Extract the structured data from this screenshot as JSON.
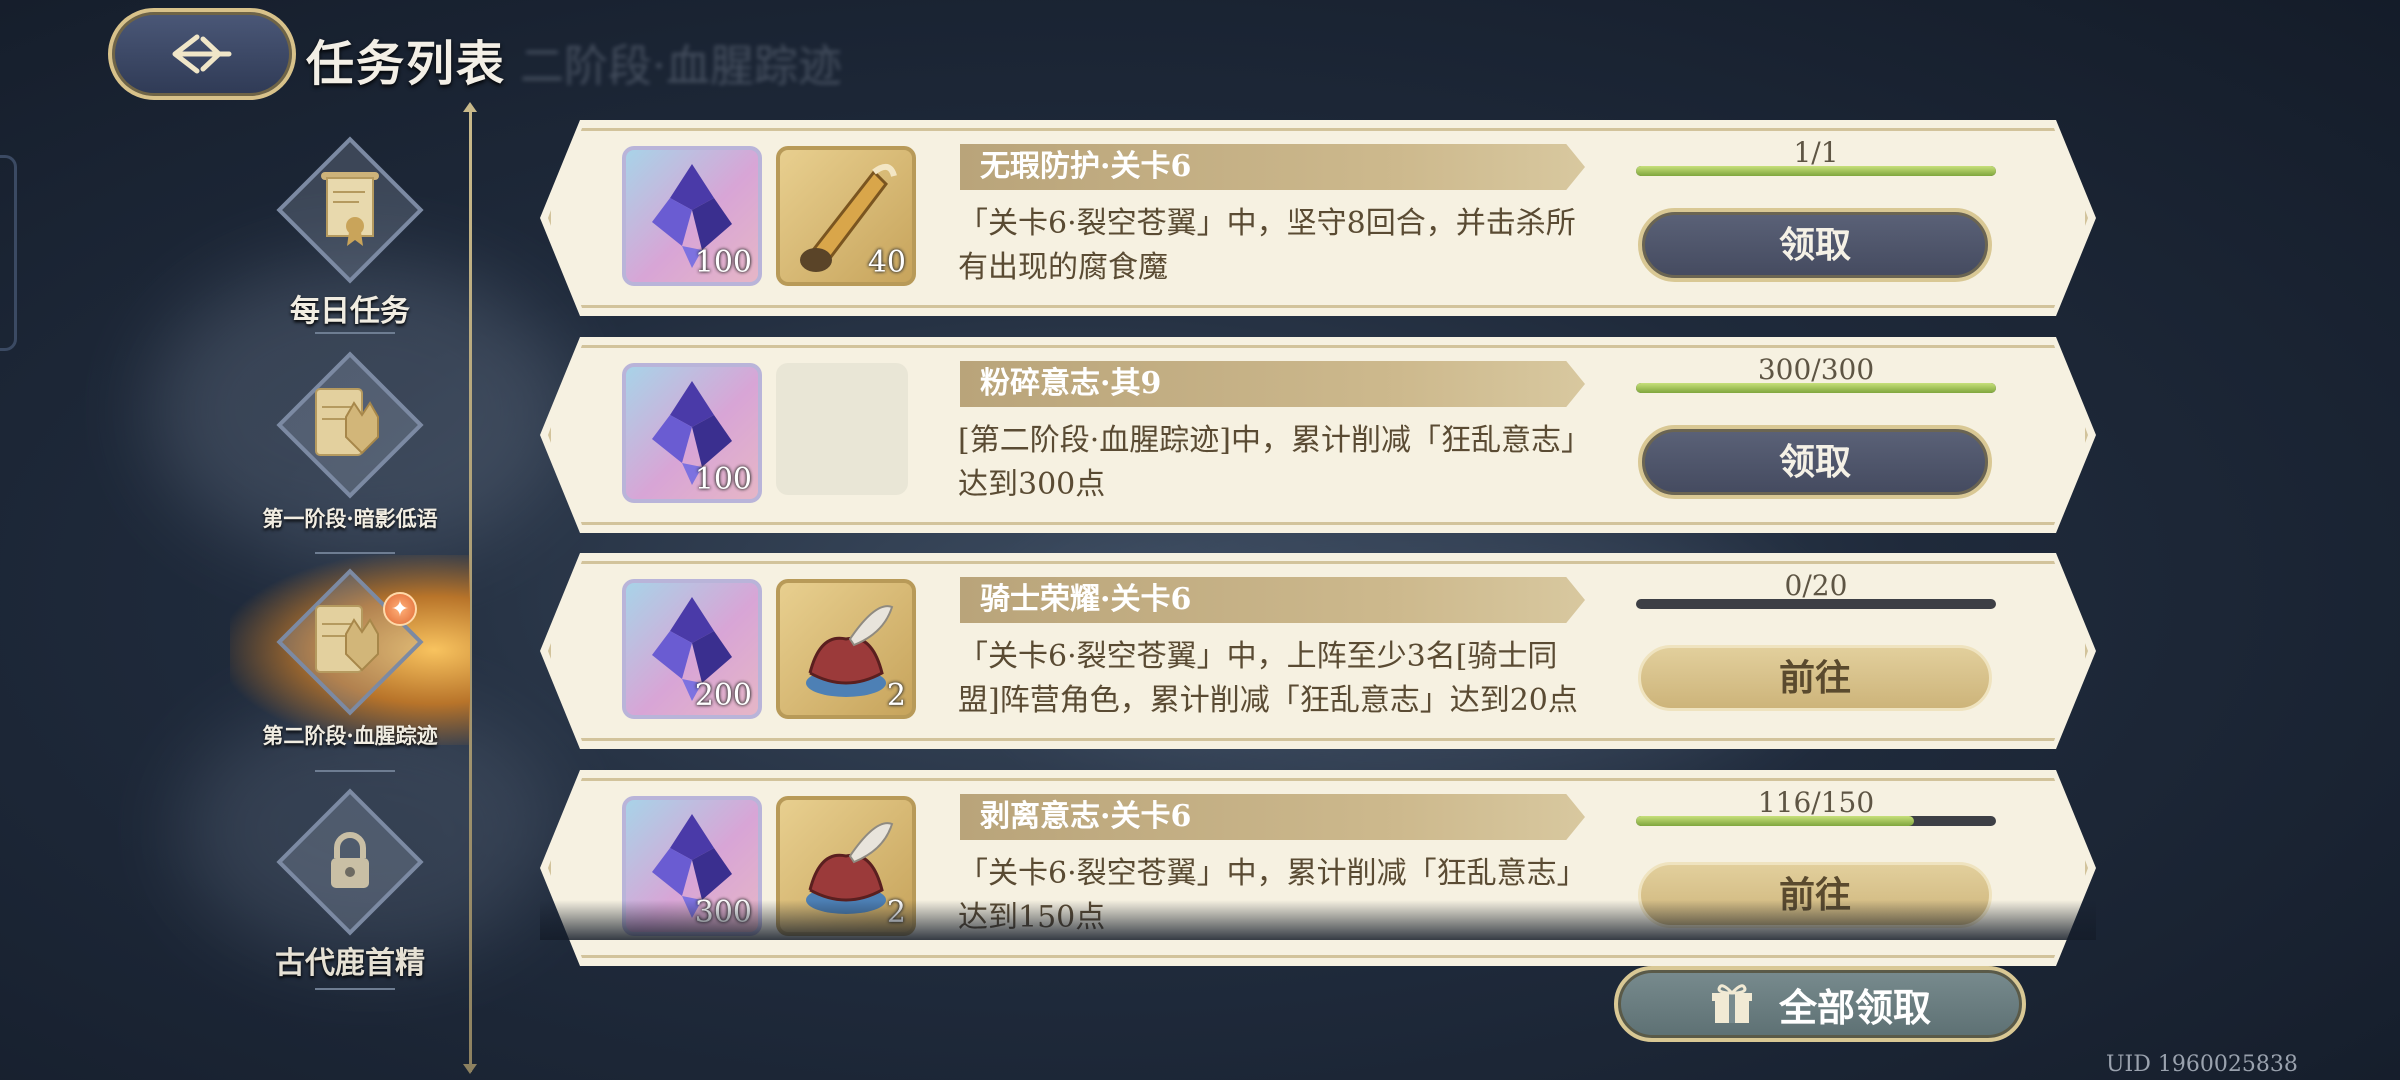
{
  "header": {
    "title": "任务列表",
    "subtitle_ghost": "二阶段·血腥踪迹"
  },
  "sidebar": {
    "items": [
      {
        "label": "每日任务",
        "icon": "scroll-icon",
        "state": "normal"
      },
      {
        "label": "第一阶段·暗影低语",
        "icon": "wolf-card-icon",
        "state": "normal"
      },
      {
        "label": "第二阶段·血腥踪迹",
        "icon": "wolf-card-icon",
        "state": "active",
        "badge": "✦"
      },
      {
        "label": "古代鹿首精",
        "icon": "lock-icon",
        "state": "locked"
      }
    ]
  },
  "tasks": [
    {
      "title": "无瑕防护·关卡6",
      "desc": "「关卡6·裂空苍翼」中，坚守8回合，并击杀所有出现的腐食魔",
      "rewards": [
        {
          "type": "crystal",
          "qty": "100"
        },
        {
          "type": "horn",
          "qty": "40"
        }
      ],
      "progress_text": "1/1",
      "progress": 1.0,
      "button": "领取",
      "button_type": "claim"
    },
    {
      "title": "粉碎意志·其9",
      "desc": "[第二阶段·血腥踪迹]中，累计削减「狂乱意志」达到300点",
      "rewards": [
        {
          "type": "crystal",
          "qty": "100"
        },
        {
          "type": "empty",
          "qty": ""
        }
      ],
      "progress_text": "300/300",
      "progress": 1.0,
      "button": "领取",
      "button_type": "claim"
    },
    {
      "title": "骑士荣耀·关卡6",
      "desc": "「关卡6·裂空苍翼」中，上阵至少3名[骑士同盟]阵营角色，累计削减「狂乱意志」达到20点",
      "rewards": [
        {
          "type": "crystal",
          "qty": "200"
        },
        {
          "type": "cloak",
          "qty": "2"
        }
      ],
      "progress_text": "0/20",
      "progress": 0.0,
      "button": "前往",
      "button_type": "go"
    },
    {
      "title": "剥离意志·关卡6",
      "desc": "「关卡6·裂空苍翼」中，累计削减「狂乱意志」达到150点",
      "rewards": [
        {
          "type": "crystal",
          "qty": "300"
        },
        {
          "type": "cloak",
          "qty": "2"
        }
      ],
      "progress_text": "116/150",
      "progress": 0.773,
      "button": "前往",
      "button_type": "go"
    }
  ],
  "claim_all": {
    "label": "全部领取",
    "icon": "gift-icon"
  },
  "uid": "UID 1960025838",
  "colors": {
    "accent_gold": "#d9c894",
    "card_bg": "#f6f1e1",
    "claim_btn": "#4f566b",
    "go_btn": "#d8c28c",
    "progress_fill": "#9fc24f"
  }
}
